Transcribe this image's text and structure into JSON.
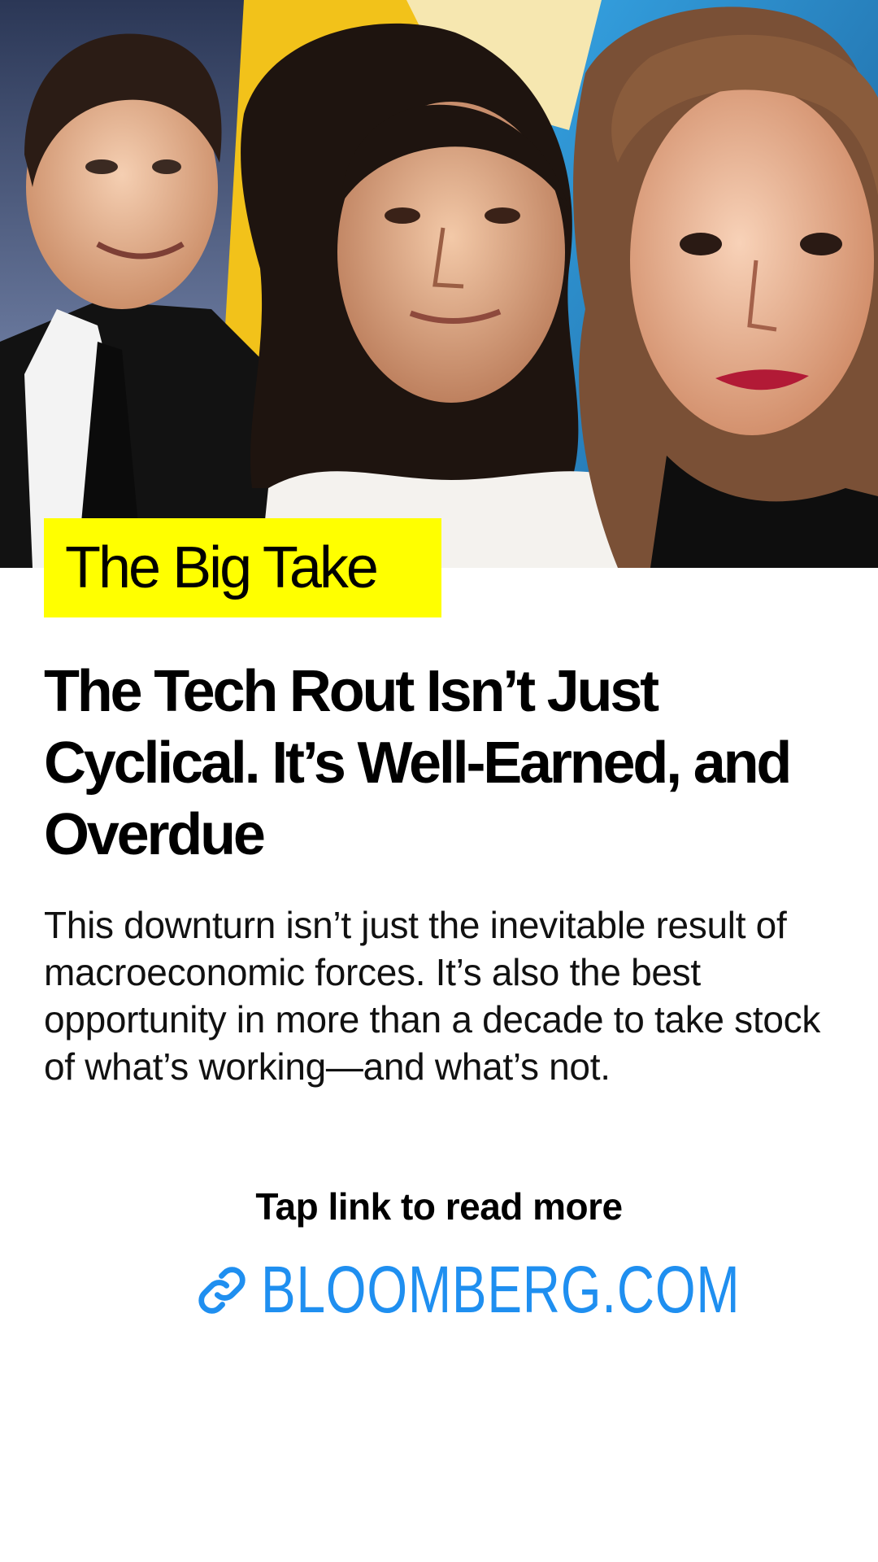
{
  "story": {
    "section_tag": "The Big Take",
    "headline": "The Tech Rout Isn’t Just Cyclical. It’s Well-Earned, and Overdue",
    "deck": "This downturn isn’t just the inevitable result of macroeconomic forces. It’s also the best opportunity in more than a decade to take stock of what’s working—and what’s not."
  },
  "cta": {
    "label": "Tap link to read more",
    "link_text": "BLOOMBERG.COM",
    "link_icon": "link-icon"
  },
  "colors": {
    "tag_background": "#ffff00",
    "link": "#1f8ff0",
    "text": "#000000",
    "background": "#ffffff"
  }
}
